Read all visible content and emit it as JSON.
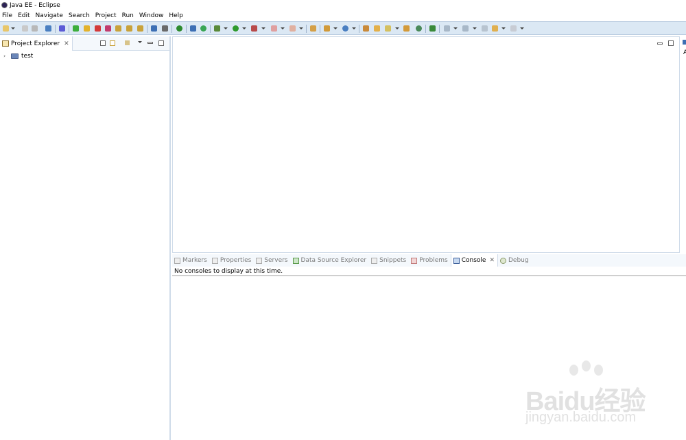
{
  "window": {
    "title": "Java EE - Eclipse"
  },
  "menu": [
    "File",
    "Edit",
    "Navigate",
    "Search",
    "Project",
    "Run",
    "Window",
    "Help"
  ],
  "colors": {
    "toolbar_bg": "#dbe8f4",
    "panel_border": "#cfdbe9"
  },
  "project_explorer": {
    "tab_label": "Project Explorer",
    "tree": [
      {
        "label": "test",
        "icon": "project-folder-icon",
        "expanded": false
      }
    ]
  },
  "right_strip": {
    "label": "A"
  },
  "bottom_panel": {
    "tabs": [
      {
        "label": "Markers",
        "icon": "markers-icon",
        "active": false
      },
      {
        "label": "Properties",
        "icon": "properties-icon",
        "active": false
      },
      {
        "label": "Servers",
        "icon": "servers-icon",
        "active": false
      },
      {
        "label": "Data Source Explorer",
        "icon": "database-icon",
        "active": false
      },
      {
        "label": "Snippets",
        "icon": "snippets-icon",
        "active": false
      },
      {
        "label": "Problems",
        "icon": "problems-icon",
        "active": false
      },
      {
        "label": "Console",
        "icon": "console-icon",
        "active": true
      },
      {
        "label": "Debug",
        "icon": "debug-icon",
        "active": false
      }
    ],
    "message": "No consoles to display at this time."
  },
  "watermark": {
    "brand": "Baidu经验",
    "url": "jingyan.baidu.com"
  }
}
